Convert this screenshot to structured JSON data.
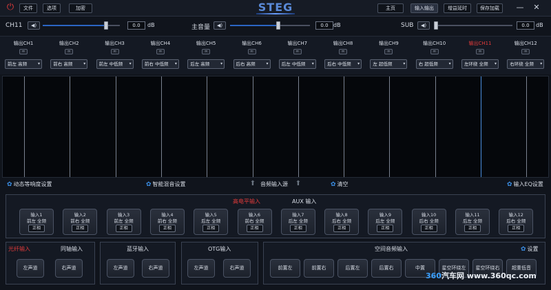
{
  "titlebar": {
    "menu": [
      "文件",
      "选项",
      "加密"
    ],
    "logo": "STEG",
    "nav": [
      "主页",
      "输入输出",
      "增益延时",
      "保存加载"
    ],
    "min_icon": "—",
    "close_icon": "✕"
  },
  "volume": {
    "ch_label": "CH11",
    "ch_value": "0.0",
    "master_label": "主音量",
    "master_value": "0.0",
    "sub_label": "SUB",
    "sub_value": "0.0",
    "unit": "dB",
    "ch_level": 0.82,
    "master_level": 0.6,
    "sub_level": 0.0
  },
  "channels": [
    {
      "name": "输出CH1",
      "select": "前左 高频",
      "active": false
    },
    {
      "name": "输出CH2",
      "select": "前右 高频",
      "active": false
    },
    {
      "name": "输出CH3",
      "select": "前左 中低频",
      "active": false
    },
    {
      "name": "输出CH4",
      "select": "前右 中低频",
      "active": false
    },
    {
      "name": "输出CH5",
      "select": "后左 高频",
      "active": false
    },
    {
      "name": "输出CH6",
      "select": "后右 高频",
      "active": false
    },
    {
      "name": "输出CH7",
      "select": "后左 中低频",
      "active": false
    },
    {
      "name": "输出CH8",
      "select": "后右 中低频",
      "active": false
    },
    {
      "name": "输出CH9",
      "select": "左 超低频",
      "active": false
    },
    {
      "name": "输出CH10",
      "select": "右 超低频",
      "active": false
    },
    {
      "name": "输出CH11",
      "select": "左环绕 全频",
      "active": true
    },
    {
      "name": "输出CH12",
      "select": "右环绕 全频",
      "active": false
    }
  ],
  "function_bar": {
    "loudness": "动态等响度设置",
    "mix": "智能混音设置",
    "source": "音频输入源",
    "clear": "清空",
    "input_eq": "输入EQ设置"
  },
  "input_section": {
    "high_level": "高电平输入",
    "aux": "AUX 输入",
    "inputs": [
      {
        "name": "输入1",
        "sub": "前左 全频",
        "btn": "正相"
      },
      {
        "name": "输入2",
        "sub": "前右 全频",
        "btn": "正相"
      },
      {
        "name": "输入3",
        "sub": "前左 全频",
        "btn": "正相"
      },
      {
        "name": "输入4",
        "sub": "前右 全频",
        "btn": "正相"
      },
      {
        "name": "输入5",
        "sub": "后左 全频",
        "btn": "正相"
      },
      {
        "name": "输入6",
        "sub": "前右 全频",
        "btn": "正相"
      },
      {
        "name": "输入7",
        "sub": "后左 全频",
        "btn": "正相"
      },
      {
        "name": "输入8",
        "sub": "后右 全频",
        "btn": "正相"
      },
      {
        "name": "输入9",
        "sub": "后左 全频",
        "btn": "正相"
      },
      {
        "name": "输入10",
        "sub": "后右 全频",
        "btn": "正相"
      },
      {
        "name": "输入11",
        "sub": "后左 全频",
        "btn": "正相"
      },
      {
        "name": "输入12",
        "sub": "后右 全频",
        "btn": "正相"
      }
    ]
  },
  "bottom": {
    "optical": "光纤输入",
    "coax": "同轴输入",
    "optical_buttons": [
      "左声道",
      "右声道"
    ],
    "bluetooth": "蓝牙输入",
    "bluetooth_buttons": [
      "左声道",
      "右声道"
    ],
    "otg": "OTG输入",
    "otg_buttons": [
      "左声道",
      "右声道"
    ],
    "spatial": "空间音频输入",
    "settings": "设置",
    "spatial_buttons": [
      "前置左",
      "前置右",
      "后置左",
      "后置右",
      "中置",
      "星空环绕左",
      "星空环绕右",
      "超重低音"
    ]
  },
  "watermark": {
    "a": "360",
    "b": "汽车网 www.360qc.com"
  },
  "colors": {
    "accent": "#3b8fe6",
    "highlight_red": "#e03a3a",
    "background": "#10141c"
  }
}
